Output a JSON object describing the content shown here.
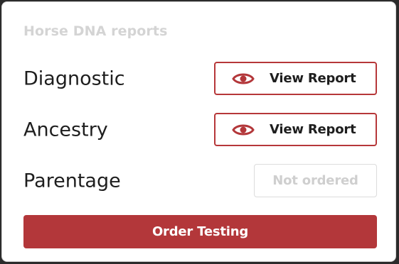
{
  "card": {
    "title": "Horse DNA reports"
  },
  "reports": [
    {
      "label": "Diagnostic",
      "action": "View Report",
      "status": "ordered"
    },
    {
      "label": "Ancestry",
      "action": "View Report",
      "status": "ordered"
    },
    {
      "label": "Parentage",
      "action": "Not ordered",
      "status": "not-ordered"
    }
  ],
  "primary_action": {
    "label": "Order Testing"
  },
  "colors": {
    "accent": "#b3373a",
    "title_muted": "#d4d4d4",
    "disabled_text": "#cfcfcf"
  },
  "icons": {
    "view": "eye-icon"
  }
}
